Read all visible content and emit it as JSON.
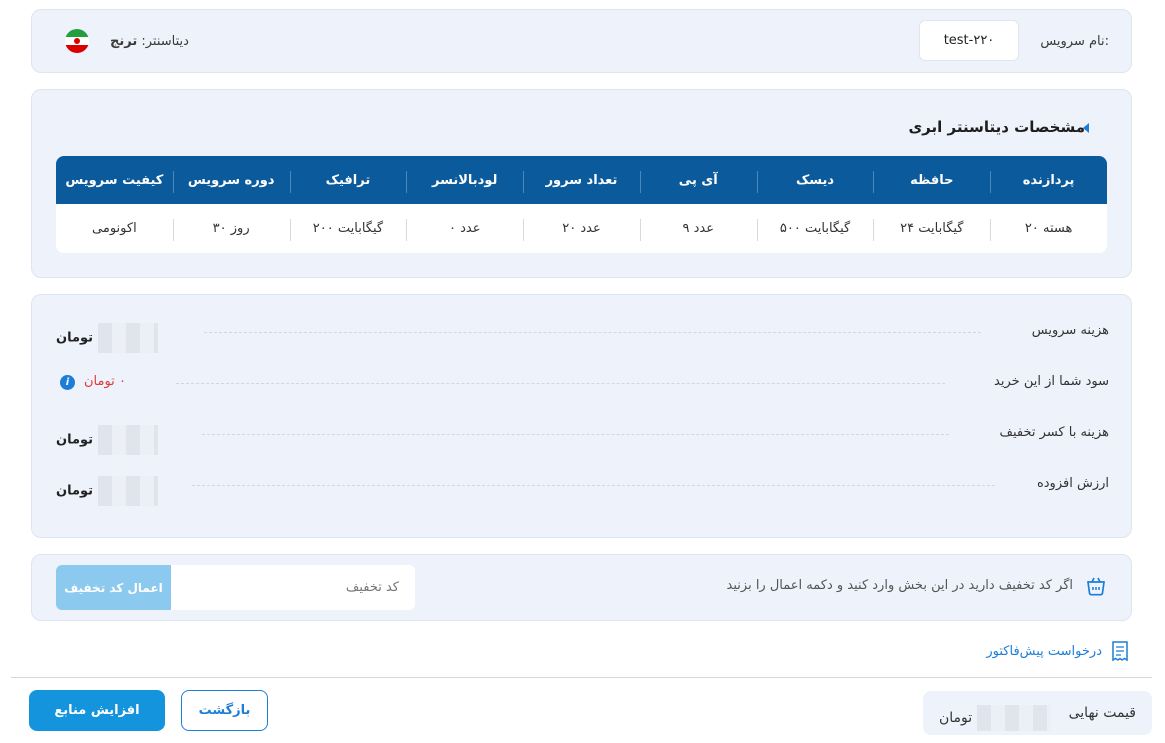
{
  "service": {
    "name_label": "نام سرویس:",
    "name_value": "test-۲۲۰",
    "datacenter_label": "دیتاسنتر:",
    "datacenter_value": "ترنج"
  },
  "specs": {
    "title": "مشخصات دیتاسنتر ابری",
    "headers": [
      "پردازنده",
      "حافظه",
      "دیسک",
      "آی پی",
      "تعداد سرور",
      "لودبالانسر",
      "ترافیک",
      "دوره سرویس",
      "کیفیت سرویس"
    ],
    "values": [
      "۲۰ هسته",
      "۲۴ گیگابایت",
      "۵۰۰ گیگابایت",
      "۹ عدد",
      "۲۰ عدد",
      "۰ عدد",
      "۲۰۰ گیگابایت",
      "۳۰ روز",
      "اکونومی"
    ]
  },
  "costs": {
    "service_cost_label": "هزینه سرویس",
    "service_cost_value": "تومان",
    "profit_label": "سود شما از این خرید",
    "profit_value": "۰ تومان",
    "discounted_label": "هزینه با کسر تخفیف",
    "discounted_value": "تومان",
    "vat_label": "ارزش افزوده",
    "vat_value": "تومان"
  },
  "coupon": {
    "text": "اگر کد تخفیف دارید در این بخش وارد کنید و دکمه اعمال را بزنید",
    "placeholder": "کد تخفیف",
    "apply_label": "اعمال کد تخفیف"
  },
  "proforma_label": "درخواست پیش‌فاکتور",
  "footer": {
    "final_price_label": "قیمت نهایی",
    "final_price_value": "تومان",
    "back_label": "بازگشت",
    "primary_label": "افزایش منابع"
  },
  "colors": {
    "accent": "#1c7ed6",
    "table_header": "#0b5a9c",
    "panel_bg": "#eef3fb",
    "danger": "#e03a3a"
  },
  "icons": {
    "flag": "iran-flag-icon",
    "info": "info-icon",
    "coupon": "basket-icon",
    "proforma": "receipt-icon"
  }
}
